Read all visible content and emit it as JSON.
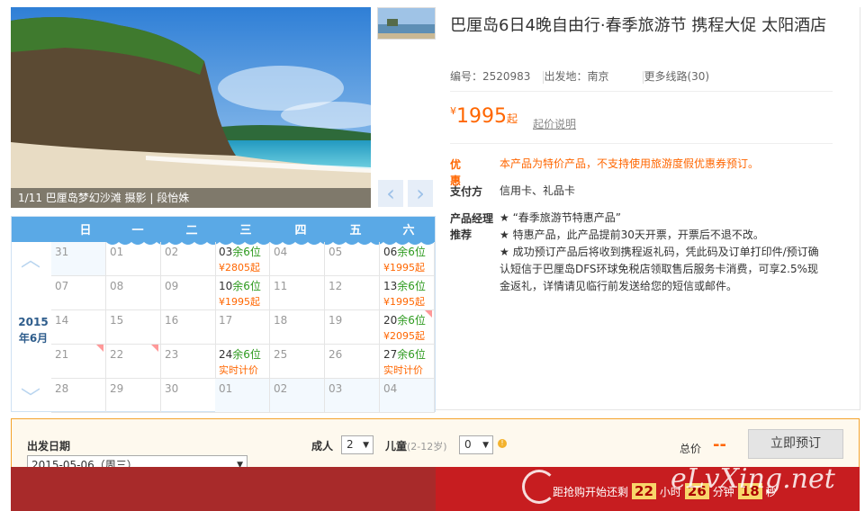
{
  "gallery": {
    "caption": "1/11 巴厘岛梦幻沙滩 摄影 | 段怡姝",
    "prev_icon": "chevron-left-icon",
    "next_icon": "chevron-right-icon"
  },
  "calendar": {
    "month_label": "2015年6月",
    "weekdays": [
      "日",
      "一",
      "二",
      "三",
      "四",
      "五",
      "六"
    ],
    "rows": [
      [
        {
          "d": "31",
          "out": true
        },
        {
          "d": "01"
        },
        {
          "d": "02"
        },
        {
          "d": "03",
          "avail": "余6位",
          "price": "¥2805起"
        },
        {
          "d": "04"
        },
        {
          "d": "05"
        },
        {
          "d": "06",
          "avail": "余6位",
          "price": "¥1995起"
        }
      ],
      [
        {
          "d": "07"
        },
        {
          "d": "08"
        },
        {
          "d": "09"
        },
        {
          "d": "10",
          "avail": "余6位",
          "price": "¥1995起"
        },
        {
          "d": "11"
        },
        {
          "d": "12"
        },
        {
          "d": "13",
          "avail": "余6位",
          "price": "¥1995起"
        }
      ],
      [
        {
          "d": "14"
        },
        {
          "d": "15"
        },
        {
          "d": "16"
        },
        {
          "d": "17"
        },
        {
          "d": "18"
        },
        {
          "d": "19"
        },
        {
          "d": "20",
          "avail": "余6位",
          "price": "¥2095起",
          "flag": true
        }
      ],
      [
        {
          "d": "21",
          "flag": true
        },
        {
          "d": "22",
          "flag": true
        },
        {
          "d": "23"
        },
        {
          "d": "24",
          "avail": "余6位",
          "price": "实时计价"
        },
        {
          "d": "25"
        },
        {
          "d": "26"
        },
        {
          "d": "27",
          "avail": "余6位",
          "price": "实时计价"
        }
      ],
      [
        {
          "d": "28"
        },
        {
          "d": "29"
        },
        {
          "d": "30"
        },
        {
          "d": "01",
          "out": true
        },
        {
          "d": "02",
          "out": true
        },
        {
          "d": "03",
          "out": true
        },
        {
          "d": "04",
          "out": true
        }
      ]
    ]
  },
  "product": {
    "title": "巴厘岛6日4晚自由行·春季旅游节 携程大促 太阳酒店",
    "code_label": "编号：2520983",
    "departure_label": "出发地：南京",
    "more_routes": "更多线路(30)",
    "price_currency": "¥",
    "price": "1995",
    "price_suffix": "起",
    "price_note": "起价说明",
    "promo_label": "优惠",
    "promo_text": "本产品为特价产品，不支持使用旅游度假优惠券预订。",
    "payment_label": "支付方",
    "payment_text": "信用卡、礼品卡",
    "recommend_label": "产品经理推荐",
    "recommend_items": [
      "★ “春季旅游节特惠产品”",
      "★ 特惠产品，此产品提前30天开票，开票后不退不改。",
      "★ 成功预订产品后将收到携程返礼码，凭此码及订单打印件/预订确认短信于巴厘岛DFS环球免税店领取售后服务卡消费，可享2.5%现金返礼，详情请见临行前发送给您的短信或邮件。"
    ]
  },
  "booking": {
    "departure_date_label": "出发日期",
    "departure_date_value": "2015-05-06（周三）",
    "adult_label": "成人",
    "adult_value": "2",
    "child_label": "儿童",
    "child_age": "(2-12岁)",
    "child_value": "0",
    "total_label": "总价",
    "total_value": "--",
    "book_button": "立即预订"
  },
  "countdown": {
    "prefix": "距抢购开始还剩",
    "hours": "22",
    "hours_unit": "小时",
    "minutes": "26",
    "minutes_unit": "分钟",
    "seconds": "18",
    "seconds_unit": "秒"
  },
  "watermark": "eLvXing.net",
  "colors": {
    "accent": "#ff6600",
    "calendar_header": "#5aa9e6",
    "available": "#2d9a1e",
    "banner_red": "#c71d20"
  }
}
